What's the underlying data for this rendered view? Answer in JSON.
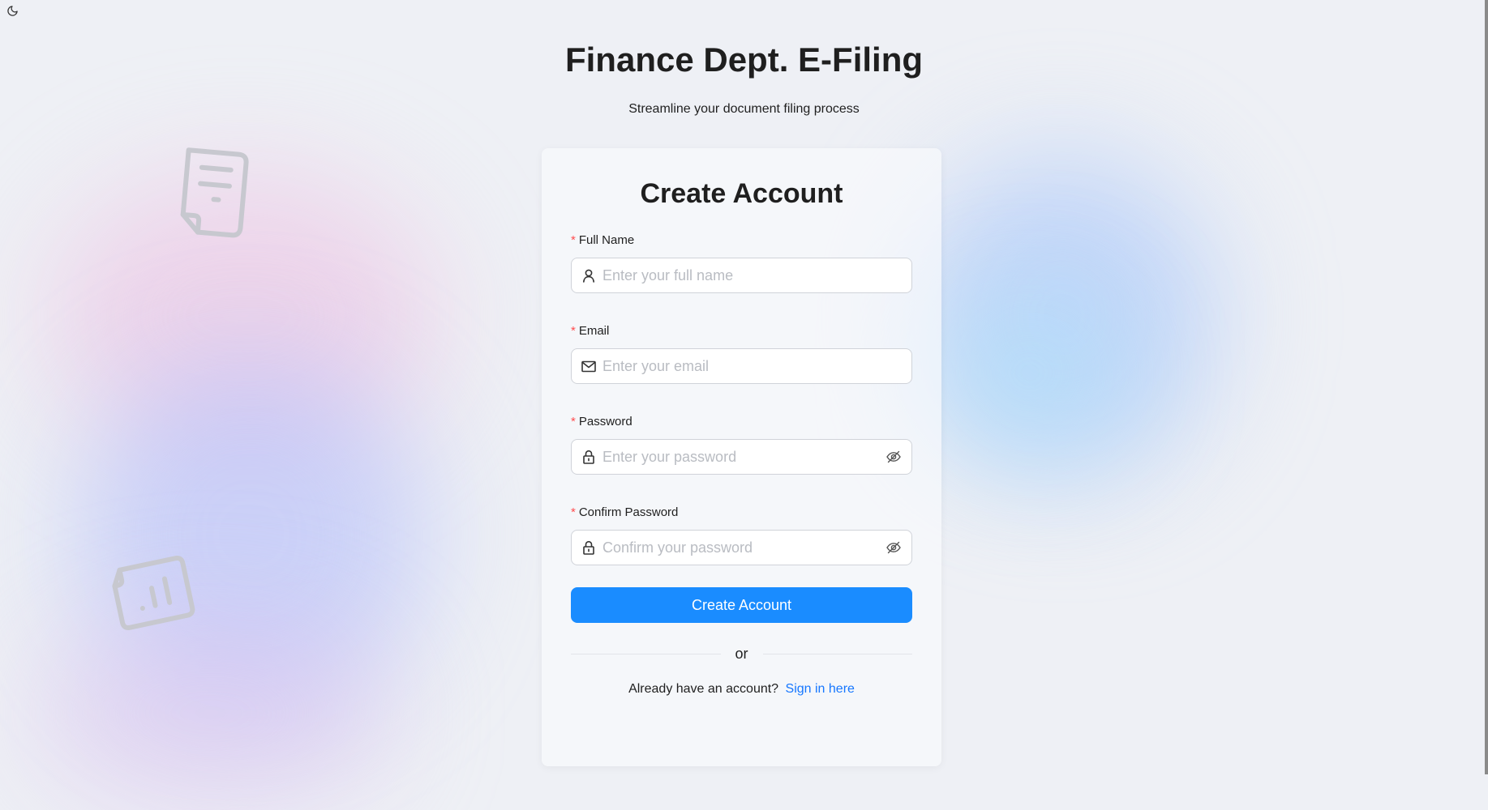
{
  "header": {
    "title": "Finance Dept. E-Filing",
    "subtitle": "Streamline your document filing process"
  },
  "theme_toggle": {
    "icon": "moon-icon"
  },
  "form": {
    "title": "Create Account",
    "fields": [
      {
        "label": "Full Name",
        "required_mark": "*",
        "placeholder": "Enter your full name",
        "value": "",
        "icon": "user-icon"
      },
      {
        "label": "Email",
        "required_mark": "*",
        "placeholder": "Enter your email",
        "value": "",
        "icon": "mail-icon"
      },
      {
        "label": "Password",
        "required_mark": "*",
        "placeholder": "Enter your password",
        "value": "",
        "icon": "lock-icon",
        "toggle_icon": "eye-invisible-icon"
      },
      {
        "label": "Confirm Password",
        "required_mark": "*",
        "placeholder": "Confirm your password",
        "value": "",
        "icon": "lock-icon",
        "toggle_icon": "eye-invisible-icon"
      }
    ],
    "submit_label": "Create Account",
    "divider_text": "or",
    "signin_prompt": "Already have an account?",
    "signin_link": "Sign in here"
  },
  "colors": {
    "primary": "#1a8cff",
    "link": "#1677ff",
    "required": "#ff4d4f",
    "text": "#1f1f1f",
    "placeholder": "#b9bcc2"
  }
}
